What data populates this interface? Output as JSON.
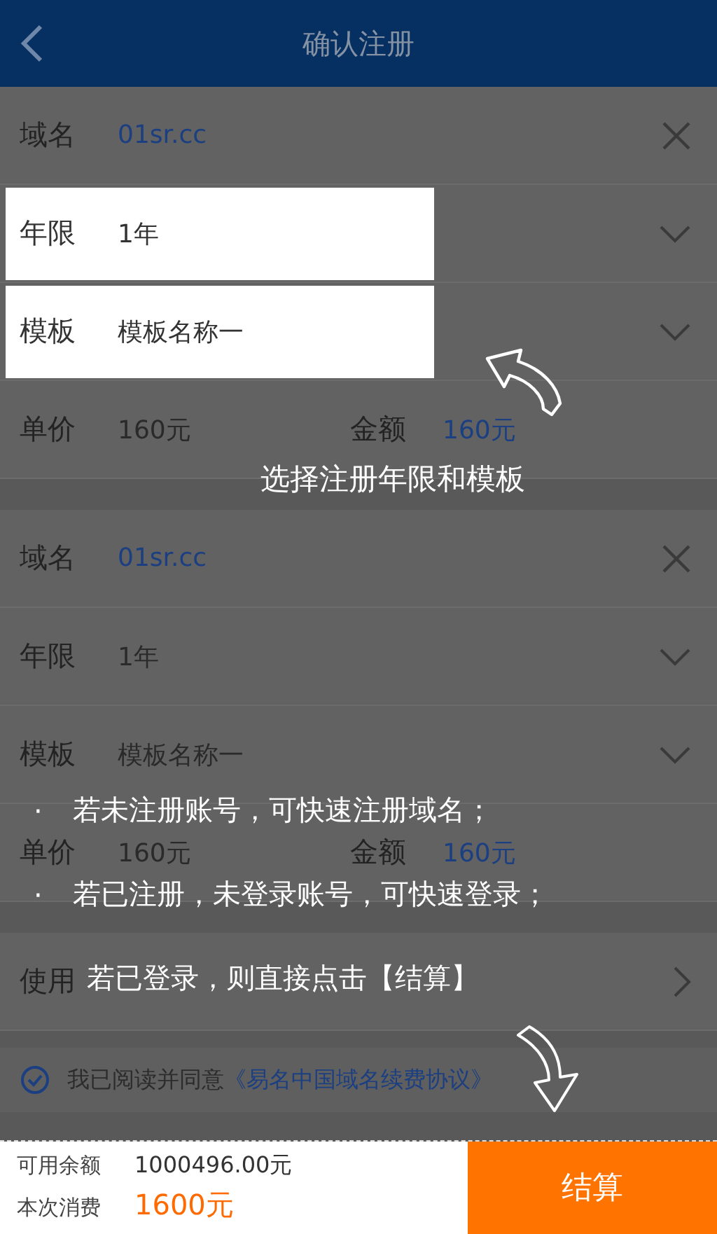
{
  "header": {
    "title": "确认注册"
  },
  "orders": [
    {
      "rows": [
        {
          "kind": "domain",
          "label": "域名",
          "value": "01sr.cc",
          "highlighted": false
        },
        {
          "kind": "select",
          "label": "年限",
          "value": "1年",
          "highlighted": true
        },
        {
          "kind": "select",
          "label": "模板",
          "value": "模板名称一",
          "highlighted": true
        },
        {
          "kind": "price",
          "label": "单价",
          "value": "160元",
          "amount_label": "金额",
          "amount": "160元",
          "highlighted": false
        }
      ]
    },
    {
      "rows": [
        {
          "kind": "domain",
          "label": "域名",
          "value": "01sr.cc",
          "highlighted": false
        },
        {
          "kind": "select",
          "label": "年限",
          "value": "1年",
          "highlighted": false
        },
        {
          "kind": "select",
          "label": "模板",
          "value": "模板名称一",
          "highlighted": false
        },
        {
          "kind": "price",
          "label": "单价",
          "value": "160元",
          "amount_label": "金额",
          "amount": "160元",
          "highlighted": false
        }
      ]
    }
  ],
  "coupon": {
    "label": "使用"
  },
  "agreement": {
    "checked": true,
    "text": "我已阅读并同意",
    "link": "《易名中国域名续费协议》"
  },
  "footer": {
    "balance_label": "可用余额",
    "balance": "1000496.00元",
    "cost_label": "本次消费",
    "cost": "1600元",
    "button": "结算"
  },
  "guide": {
    "caption": "选择注册年限和模板",
    "tips": [
      {
        "bullet": "·",
        "text": "若未注册账号，可快速注册域名；"
      },
      {
        "bullet": "·",
        "text": "若已注册，未登录账号，可快速登录；"
      },
      {
        "text": "若已登录，则直接点击【结算】"
      }
    ]
  }
}
